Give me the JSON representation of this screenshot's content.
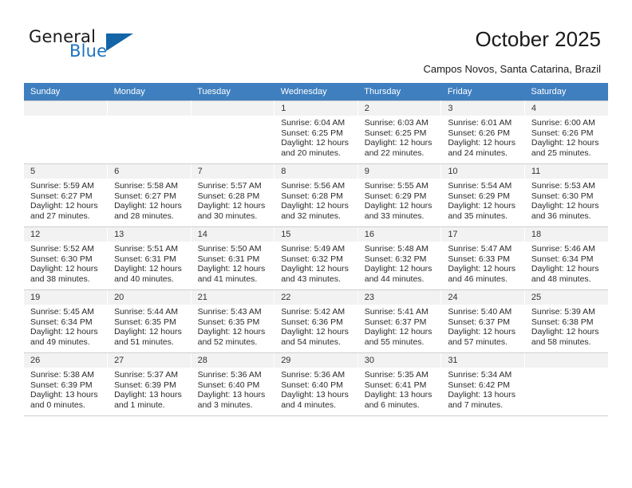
{
  "brand": {
    "name_part1": "General",
    "name_part2": "Blue",
    "triangle_color": "#1464a8",
    "blue_color": "#1d73bf"
  },
  "header": {
    "title": "October 2025",
    "subtitle": "Campos Novos, Santa Catarina, Brazil"
  },
  "theme": {
    "header_row_bg": "#3f7fbf",
    "header_row_text": "#ffffff",
    "daynum_bg": "#f2f2f2",
    "grid_line": "#cfcfcf"
  },
  "weekdays": [
    "Sunday",
    "Monday",
    "Tuesday",
    "Wednesday",
    "Thursday",
    "Friday",
    "Saturday"
  ],
  "weeks": [
    [
      {
        "day": "",
        "empty": true,
        "sunrise": "",
        "sunset": "",
        "daylight": ""
      },
      {
        "day": "",
        "empty": true,
        "sunrise": "",
        "sunset": "",
        "daylight": ""
      },
      {
        "day": "",
        "empty": true,
        "sunrise": "",
        "sunset": "",
        "daylight": ""
      },
      {
        "day": "1",
        "sunrise": "Sunrise: 6:04 AM",
        "sunset": "Sunset: 6:25 PM",
        "daylight": "Daylight: 12 hours and 20 minutes."
      },
      {
        "day": "2",
        "sunrise": "Sunrise: 6:03 AM",
        "sunset": "Sunset: 6:25 PM",
        "daylight": "Daylight: 12 hours and 22 minutes."
      },
      {
        "day": "3",
        "sunrise": "Sunrise: 6:01 AM",
        "sunset": "Sunset: 6:26 PM",
        "daylight": "Daylight: 12 hours and 24 minutes."
      },
      {
        "day": "4",
        "sunrise": "Sunrise: 6:00 AM",
        "sunset": "Sunset: 6:26 PM",
        "daylight": "Daylight: 12 hours and 25 minutes."
      }
    ],
    [
      {
        "day": "5",
        "sunrise": "Sunrise: 5:59 AM",
        "sunset": "Sunset: 6:27 PM",
        "daylight": "Daylight: 12 hours and 27 minutes."
      },
      {
        "day": "6",
        "sunrise": "Sunrise: 5:58 AM",
        "sunset": "Sunset: 6:27 PM",
        "daylight": "Daylight: 12 hours and 28 minutes."
      },
      {
        "day": "7",
        "sunrise": "Sunrise: 5:57 AM",
        "sunset": "Sunset: 6:28 PM",
        "daylight": "Daylight: 12 hours and 30 minutes."
      },
      {
        "day": "8",
        "sunrise": "Sunrise: 5:56 AM",
        "sunset": "Sunset: 6:28 PM",
        "daylight": "Daylight: 12 hours and 32 minutes."
      },
      {
        "day": "9",
        "sunrise": "Sunrise: 5:55 AM",
        "sunset": "Sunset: 6:29 PM",
        "daylight": "Daylight: 12 hours and 33 minutes."
      },
      {
        "day": "10",
        "sunrise": "Sunrise: 5:54 AM",
        "sunset": "Sunset: 6:29 PM",
        "daylight": "Daylight: 12 hours and 35 minutes."
      },
      {
        "day": "11",
        "sunrise": "Sunrise: 5:53 AM",
        "sunset": "Sunset: 6:30 PM",
        "daylight": "Daylight: 12 hours and 36 minutes."
      }
    ],
    [
      {
        "day": "12",
        "sunrise": "Sunrise: 5:52 AM",
        "sunset": "Sunset: 6:30 PM",
        "daylight": "Daylight: 12 hours and 38 minutes."
      },
      {
        "day": "13",
        "sunrise": "Sunrise: 5:51 AM",
        "sunset": "Sunset: 6:31 PM",
        "daylight": "Daylight: 12 hours and 40 minutes."
      },
      {
        "day": "14",
        "sunrise": "Sunrise: 5:50 AM",
        "sunset": "Sunset: 6:31 PM",
        "daylight": "Daylight: 12 hours and 41 minutes."
      },
      {
        "day": "15",
        "sunrise": "Sunrise: 5:49 AM",
        "sunset": "Sunset: 6:32 PM",
        "daylight": "Daylight: 12 hours and 43 minutes."
      },
      {
        "day": "16",
        "sunrise": "Sunrise: 5:48 AM",
        "sunset": "Sunset: 6:32 PM",
        "daylight": "Daylight: 12 hours and 44 minutes."
      },
      {
        "day": "17",
        "sunrise": "Sunrise: 5:47 AM",
        "sunset": "Sunset: 6:33 PM",
        "daylight": "Daylight: 12 hours and 46 minutes."
      },
      {
        "day": "18",
        "sunrise": "Sunrise: 5:46 AM",
        "sunset": "Sunset: 6:34 PM",
        "daylight": "Daylight: 12 hours and 48 minutes."
      }
    ],
    [
      {
        "day": "19",
        "sunrise": "Sunrise: 5:45 AM",
        "sunset": "Sunset: 6:34 PM",
        "daylight": "Daylight: 12 hours and 49 minutes."
      },
      {
        "day": "20",
        "sunrise": "Sunrise: 5:44 AM",
        "sunset": "Sunset: 6:35 PM",
        "daylight": "Daylight: 12 hours and 51 minutes."
      },
      {
        "day": "21",
        "sunrise": "Sunrise: 5:43 AM",
        "sunset": "Sunset: 6:35 PM",
        "daylight": "Daylight: 12 hours and 52 minutes."
      },
      {
        "day": "22",
        "sunrise": "Sunrise: 5:42 AM",
        "sunset": "Sunset: 6:36 PM",
        "daylight": "Daylight: 12 hours and 54 minutes."
      },
      {
        "day": "23",
        "sunrise": "Sunrise: 5:41 AM",
        "sunset": "Sunset: 6:37 PM",
        "daylight": "Daylight: 12 hours and 55 minutes."
      },
      {
        "day": "24",
        "sunrise": "Sunrise: 5:40 AM",
        "sunset": "Sunset: 6:37 PM",
        "daylight": "Daylight: 12 hours and 57 minutes."
      },
      {
        "day": "25",
        "sunrise": "Sunrise: 5:39 AM",
        "sunset": "Sunset: 6:38 PM",
        "daylight": "Daylight: 12 hours and 58 minutes."
      }
    ],
    [
      {
        "day": "26",
        "sunrise": "Sunrise: 5:38 AM",
        "sunset": "Sunset: 6:39 PM",
        "daylight": "Daylight: 13 hours and 0 minutes."
      },
      {
        "day": "27",
        "sunrise": "Sunrise: 5:37 AM",
        "sunset": "Sunset: 6:39 PM",
        "daylight": "Daylight: 13 hours and 1 minute."
      },
      {
        "day": "28",
        "sunrise": "Sunrise: 5:36 AM",
        "sunset": "Sunset: 6:40 PM",
        "daylight": "Daylight: 13 hours and 3 minutes."
      },
      {
        "day": "29",
        "sunrise": "Sunrise: 5:36 AM",
        "sunset": "Sunset: 6:40 PM",
        "daylight": "Daylight: 13 hours and 4 minutes."
      },
      {
        "day": "30",
        "sunrise": "Sunrise: 5:35 AM",
        "sunset": "Sunset: 6:41 PM",
        "daylight": "Daylight: 13 hours and 6 minutes."
      },
      {
        "day": "31",
        "sunrise": "Sunrise: 5:34 AM",
        "sunset": "Sunset: 6:42 PM",
        "daylight": "Daylight: 13 hours and 7 minutes."
      },
      {
        "day": "",
        "empty": true,
        "sunrise": "",
        "sunset": "",
        "daylight": ""
      }
    ]
  ]
}
